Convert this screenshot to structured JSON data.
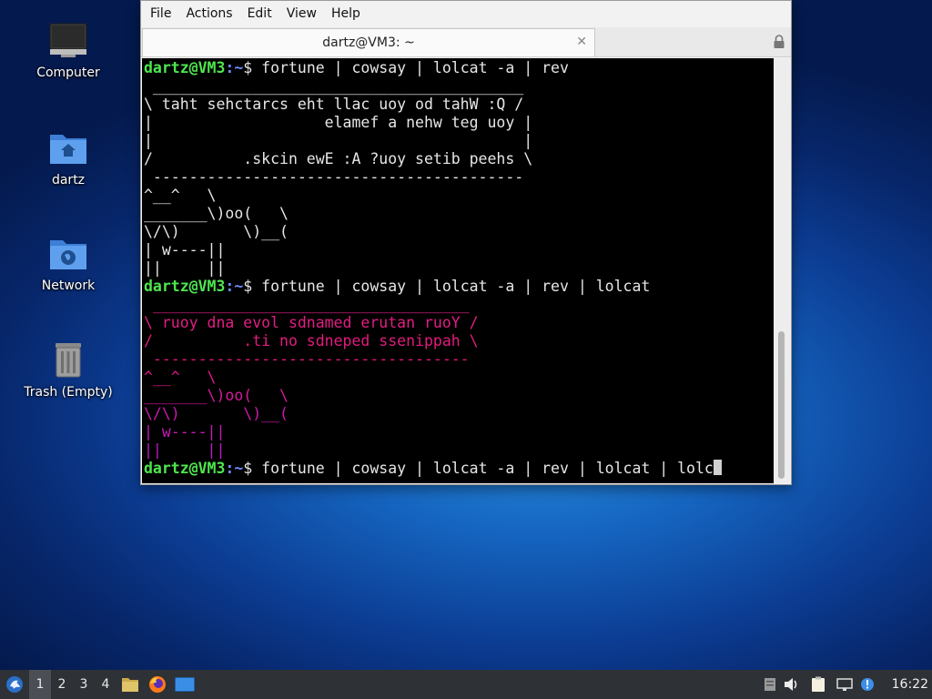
{
  "desktop": {
    "icons": [
      {
        "label": "Computer",
        "icon": "computer-icon"
      },
      {
        "label": "dartz",
        "icon": "home-folder-icon"
      },
      {
        "label": "Network",
        "icon": "network-folder-icon"
      },
      {
        "label": "Trash (Empty)",
        "icon": "trash-icon"
      }
    ]
  },
  "terminal": {
    "menu": [
      "File",
      "Actions",
      "Edit",
      "View",
      "Help"
    ],
    "tab_title": "dartz@VM3: ~",
    "prompt_user": "dartz@VM3",
    "prompt_path": ":~",
    "prompt_symbol": "$ ",
    "commands": [
      "fortune | cowsay | lolcat -a | rev",
      "fortune | cowsay | lolcat -a | rev | lolcat",
      "fortune | cowsay | lolcat -a | rev | lolcat | lolc"
    ],
    "output1": [
      " _________________________________________",
      "\\ taht sehctarcs eht llac uoy od tahW :Q /",
      "|                   elamef a nehw teg uoy |",
      "|                                         |",
      "/          .skcin ewE :A ?uoy setib peehs \\",
      " -----------------------------------------",
      "^__^   \\",
      "_______\\)oo(   \\",
      "\\/\\)       \\)__(",
      "| w----||",
      "||     ||"
    ],
    "output2": [
      " ___________________________________",
      "\\ ruoy dna evol sdnamed erutan ruoY /",
      "/          .ti no sdneped ssenippah \\",
      " -----------------------------------",
      "^__^   \\",
      "_______\\)oo(   \\",
      "\\/\\)       \\)__(",
      "| w----||",
      "||     ||"
    ],
    "output2_colors": [
      "#e0208a",
      "#e21d84",
      "#e31a7e",
      "#e3177a",
      "#e0168c",
      "#d8179e",
      "#cf18ad",
      "#c719b8",
      "#be1ac4"
    ]
  },
  "taskbar": {
    "workspaces": [
      "1",
      "2",
      "3",
      "4"
    ],
    "active_workspace": "1",
    "apps": [
      "menu-icon",
      "file-manager-icon",
      "firefox-icon",
      "terminal-icon"
    ],
    "tray": [
      "notes-icon",
      "volume-icon",
      "clipboard-icon",
      "network-icon",
      "update-icon"
    ],
    "clock": "16:22"
  }
}
